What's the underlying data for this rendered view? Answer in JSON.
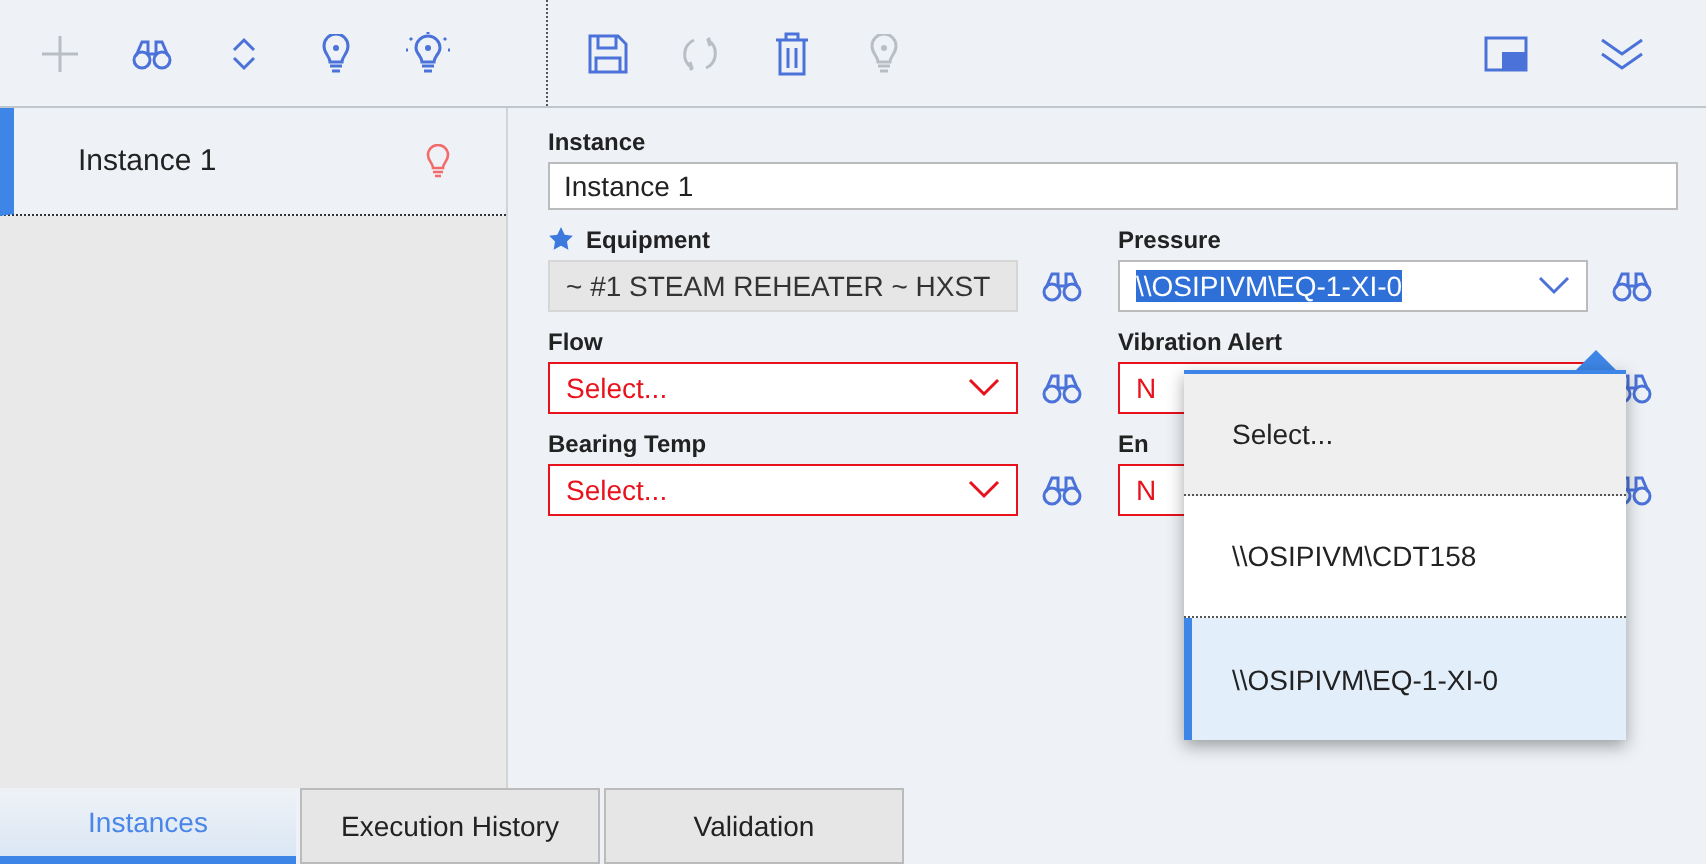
{
  "toolbar": {
    "left": [
      {
        "kind": "plus",
        "disabled": true
      },
      {
        "kind": "binoculars",
        "disabled": false
      },
      {
        "kind": "updown",
        "disabled": false
      },
      {
        "kind": "bulb",
        "disabled": false
      },
      {
        "kind": "bulb-rays",
        "disabled": false
      }
    ],
    "middle": [
      {
        "kind": "save",
        "disabled": false
      },
      {
        "kind": "refresh",
        "disabled": true
      },
      {
        "kind": "trash",
        "disabled": false
      },
      {
        "kind": "bulb",
        "disabled": true
      }
    ],
    "right": [
      {
        "kind": "window",
        "disabled": false
      },
      {
        "kind": "double-chevron",
        "disabled": false
      }
    ]
  },
  "instances": [
    {
      "name": "Instance 1",
      "selected": true
    }
  ],
  "form": {
    "instance": {
      "label": "Instance",
      "value": "Instance 1"
    },
    "fields": [
      {
        "label": "Equipment",
        "required": true,
        "kind": "readonly",
        "value": "~ #1 STEAM REHEATER ~ HXST",
        "invalid": false
      },
      {
        "label": "Pressure",
        "required": false,
        "kind": "select",
        "value": "\\\\OSIPIVM\\EQ-1-XI-0",
        "invalid": false,
        "highlighted": true
      },
      {
        "label": "Flow",
        "required": false,
        "kind": "select",
        "value": "Select...",
        "invalid": true
      },
      {
        "label": "Vibration Alert",
        "required": false,
        "kind": "select",
        "value": "N",
        "invalid": true
      },
      {
        "label": "Bearing Temp",
        "required": false,
        "kind": "select",
        "value": "Select...",
        "invalid": true
      },
      {
        "label": "En",
        "required": false,
        "kind": "select",
        "value": "N",
        "invalid": true
      }
    ]
  },
  "dropdown": {
    "options": [
      {
        "label": "Select...",
        "selected": false,
        "hovered": true
      },
      {
        "label": "\\\\OSIPIVM\\CDT158",
        "selected": false,
        "hovered": false
      },
      {
        "label": "\\\\OSIPIVM\\EQ-1-XI-0",
        "selected": true,
        "hovered": false
      }
    ]
  },
  "tabs": [
    {
      "label": "Instances",
      "selected": true
    },
    {
      "label": "Execution History",
      "selected": false
    },
    {
      "label": "Validation",
      "selected": false
    }
  ]
}
